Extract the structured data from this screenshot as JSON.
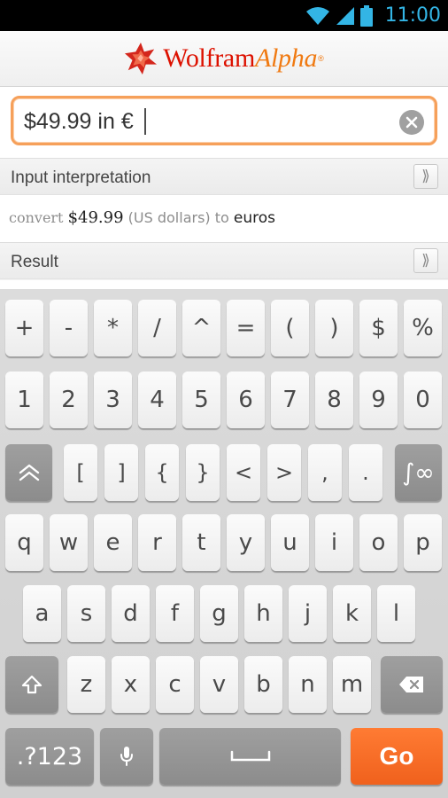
{
  "status_bar": {
    "time": "11:00"
  },
  "header": {
    "logo_word1": "Wolfram",
    "logo_word2": "Alpha",
    "logo_mark": "®"
  },
  "search": {
    "value": "$49.99 in €"
  },
  "pods": {
    "input_interpretation": {
      "title": "Input interpretation",
      "expand": "⟫",
      "parts": {
        "convert": "convert",
        "amount": "$49.99",
        "unit": "(US dollars)",
        "to": "to",
        "target": "euros"
      }
    },
    "result": {
      "title": "Result",
      "expand": "⟫"
    }
  },
  "keyboard": {
    "row1": [
      "+",
      "-",
      "*",
      "/",
      "^",
      "=",
      "(",
      ")",
      "$",
      "%"
    ],
    "row2": [
      "1",
      "2",
      "3",
      "4",
      "5",
      "6",
      "7",
      "8",
      "9",
      "0"
    ],
    "row3": [
      "[",
      "]",
      "{",
      "}",
      "<",
      ">",
      ",",
      "."
    ],
    "row4": [
      "q",
      "w",
      "e",
      "r",
      "t",
      "y",
      "u",
      "i",
      "o",
      "p"
    ],
    "row5": [
      "a",
      "s",
      "d",
      "f",
      "g",
      "h",
      "j",
      "k",
      "l"
    ],
    "row6": [
      "z",
      "x",
      "c",
      "v",
      "b",
      "n",
      "m"
    ],
    "special": {
      "math_key": "∫∞",
      "symbols": ".?123",
      "go": "Go"
    },
    "colors": {
      "go": "#f26522",
      "dark_key": "#979797",
      "focus_border": "#f6a05a"
    }
  }
}
